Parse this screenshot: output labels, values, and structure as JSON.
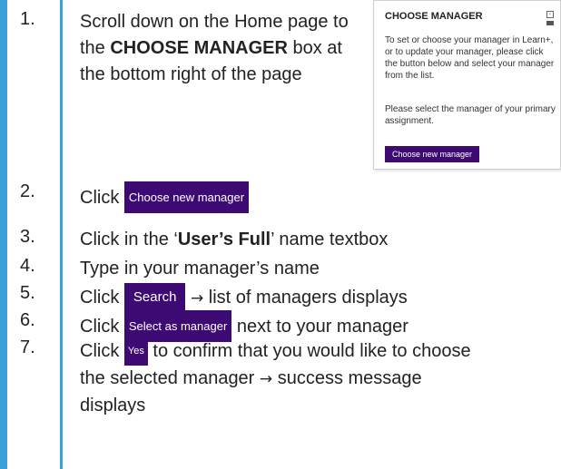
{
  "steps": [
    {
      "num": "1.",
      "text_a": "Scroll down on the Home page to the ",
      "bold": "CHOOSE MANAGER",
      "text_b": " box at the bottom right of the page"
    },
    {
      "num": "2.",
      "pre": "Click ",
      "button": "Choose new manager"
    },
    {
      "num": "3.",
      "pre": "Click in the ‘",
      "bold": "User’s Full",
      "post": "’ name textbox"
    },
    {
      "num": "4.",
      "text": "Type in your manager’s name"
    },
    {
      "num": "5.",
      "pre": "Click ",
      "button": "Search",
      "arrow": "→",
      "post": " list of managers displays"
    },
    {
      "num": "6.",
      "pre": "Click ",
      "button": "Select as manager",
      "post": " next to your manager"
    },
    {
      "num": "7.",
      "pre": "Click ",
      "button": "Yes",
      "post": " to confirm that you would like to choose the selected manager ",
      "arrow": "→",
      "post2": " success message displays"
    }
  ],
  "panel": {
    "title": "CHOOSE MANAGER",
    "p1": "To set or choose your manager in Learn+, or to update your manager, please click the button below and select your manager from the list.",
    "p2": "Please select the manager of your primary assignment.",
    "button": "Choose new manager"
  },
  "colors": {
    "accent_blue": "#3aa0d8",
    "button_purple": "#3d0a73"
  }
}
